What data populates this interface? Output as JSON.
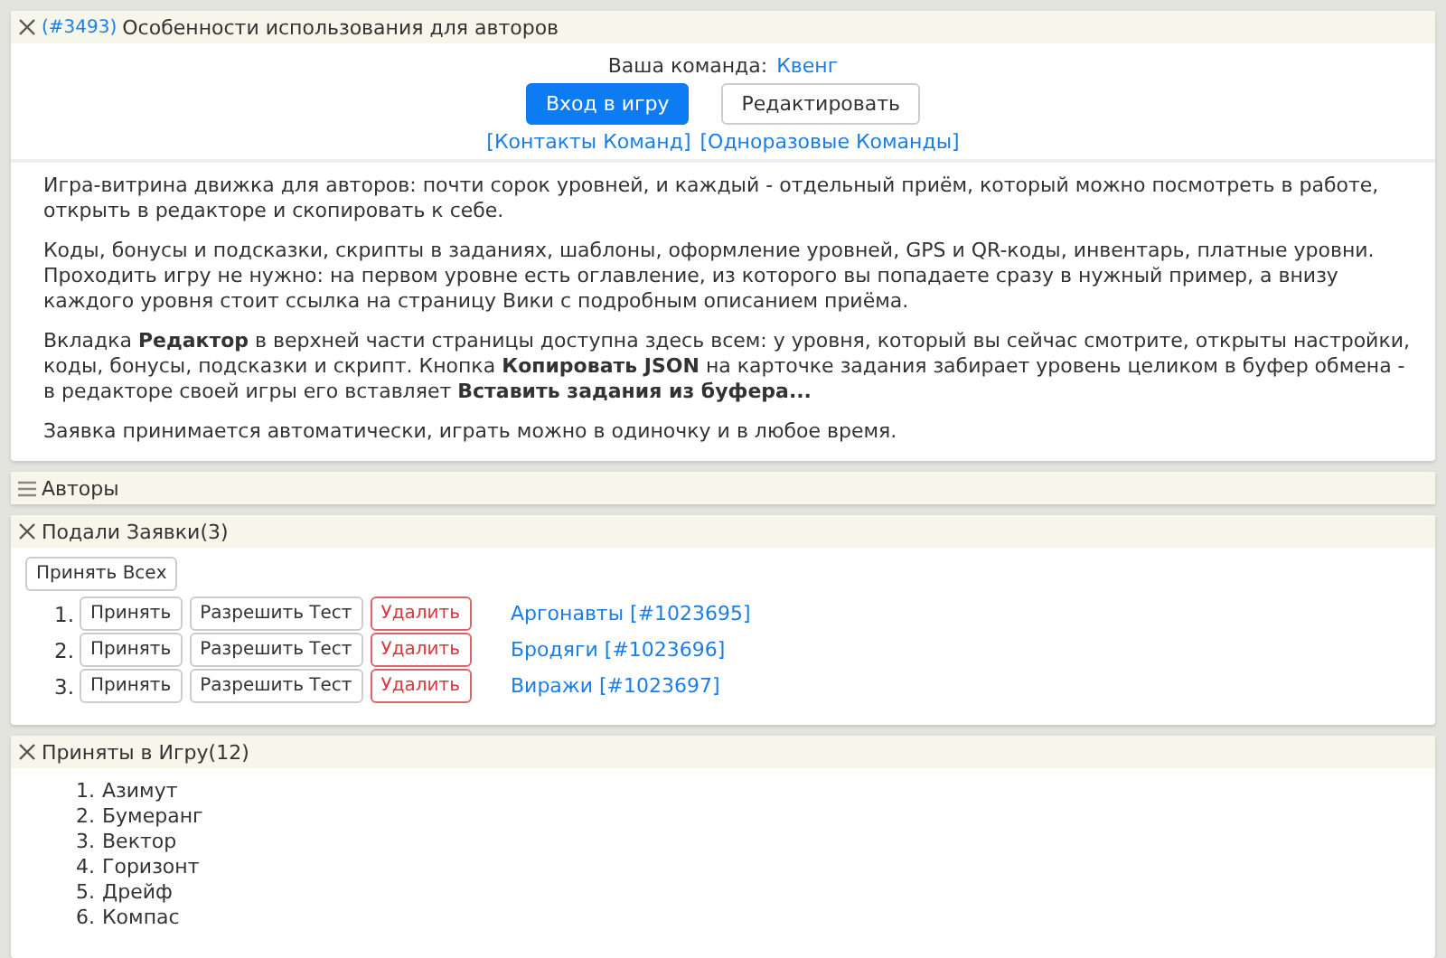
{
  "game_panel": {
    "expanded": true,
    "id": "(#3493)",
    "title": "Особенности использования для авторов",
    "team_label": "Ваша команда:",
    "team_name": "Квенг",
    "enter_button": "Вход в игру",
    "edit_button": "Редактировать",
    "links": [
      "[Контакты Команд]",
      "[Одноразовые Команды]"
    ],
    "paragraphs": [
      "Игра-витрина движка для авторов: почти сорок уровней, и каждый - отдельный приём, который можно посмотреть в работе, открыть в редакторе и скопировать к себе.",
      "Коды, бонусы и подсказки, скрипты в заданиях, шаблоны, оформление уровней, GPS и QR-коды, инвентарь, платные уровни. Проходить игру не нужно: на первом уровне есть оглавление, из которого вы попадаете сразу в нужный пример, а внизу каждого уровня стоит ссылка на страницу Вики с подробным описанием приёма.",
      "Вкладка **Редактор** в верхней части страницы доступна здесь всем: у уровня, который вы сейчас смотрите, открыты настройки, коды, бонусы, подсказки и скрипт. Кнопка **Копировать JSON** на карточке задания забирает уровень целиком в буфер обмена - в редакторе своей игры его вставляет **Вставить задания из буфера...**",
      "Заявка принимается автоматически, играть можно в одиночку и в любое время."
    ]
  },
  "authors_panel": {
    "expanded": false,
    "title": "Авторы"
  },
  "requests_panel": {
    "expanded": true,
    "title": "Подали Заявки(3)",
    "accept_all_button": "Принять Всех",
    "rows": [
      {
        "number": "1.",
        "accept": "Принять",
        "allow_test": "Разрешить Тест",
        "delete": "Удалить",
        "team": "Аргонавты [#1023695]"
      },
      {
        "number": "2.",
        "accept": "Принять",
        "allow_test": "Разрешить Тест",
        "delete": "Удалить",
        "team": "Бродяги [#1023696]"
      },
      {
        "number": "3.",
        "accept": "Принять",
        "allow_test": "Разрешить Тест",
        "delete": "Удалить",
        "team": "Виражи [#1023697]"
      }
    ]
  },
  "accepted_panel": {
    "expanded": true,
    "title": "Приняты в Игру(12)",
    "teams": [
      {
        "number": "1.",
        "name": "Азимут"
      },
      {
        "number": "2.",
        "name": "Бумеранг"
      },
      {
        "number": "3.",
        "name": "Вектор"
      },
      {
        "number": "4.",
        "name": "Горизонт"
      },
      {
        "number": "5.",
        "name": "Дрейф"
      },
      {
        "number": "6.",
        "name": "Компас"
      }
    ]
  }
}
